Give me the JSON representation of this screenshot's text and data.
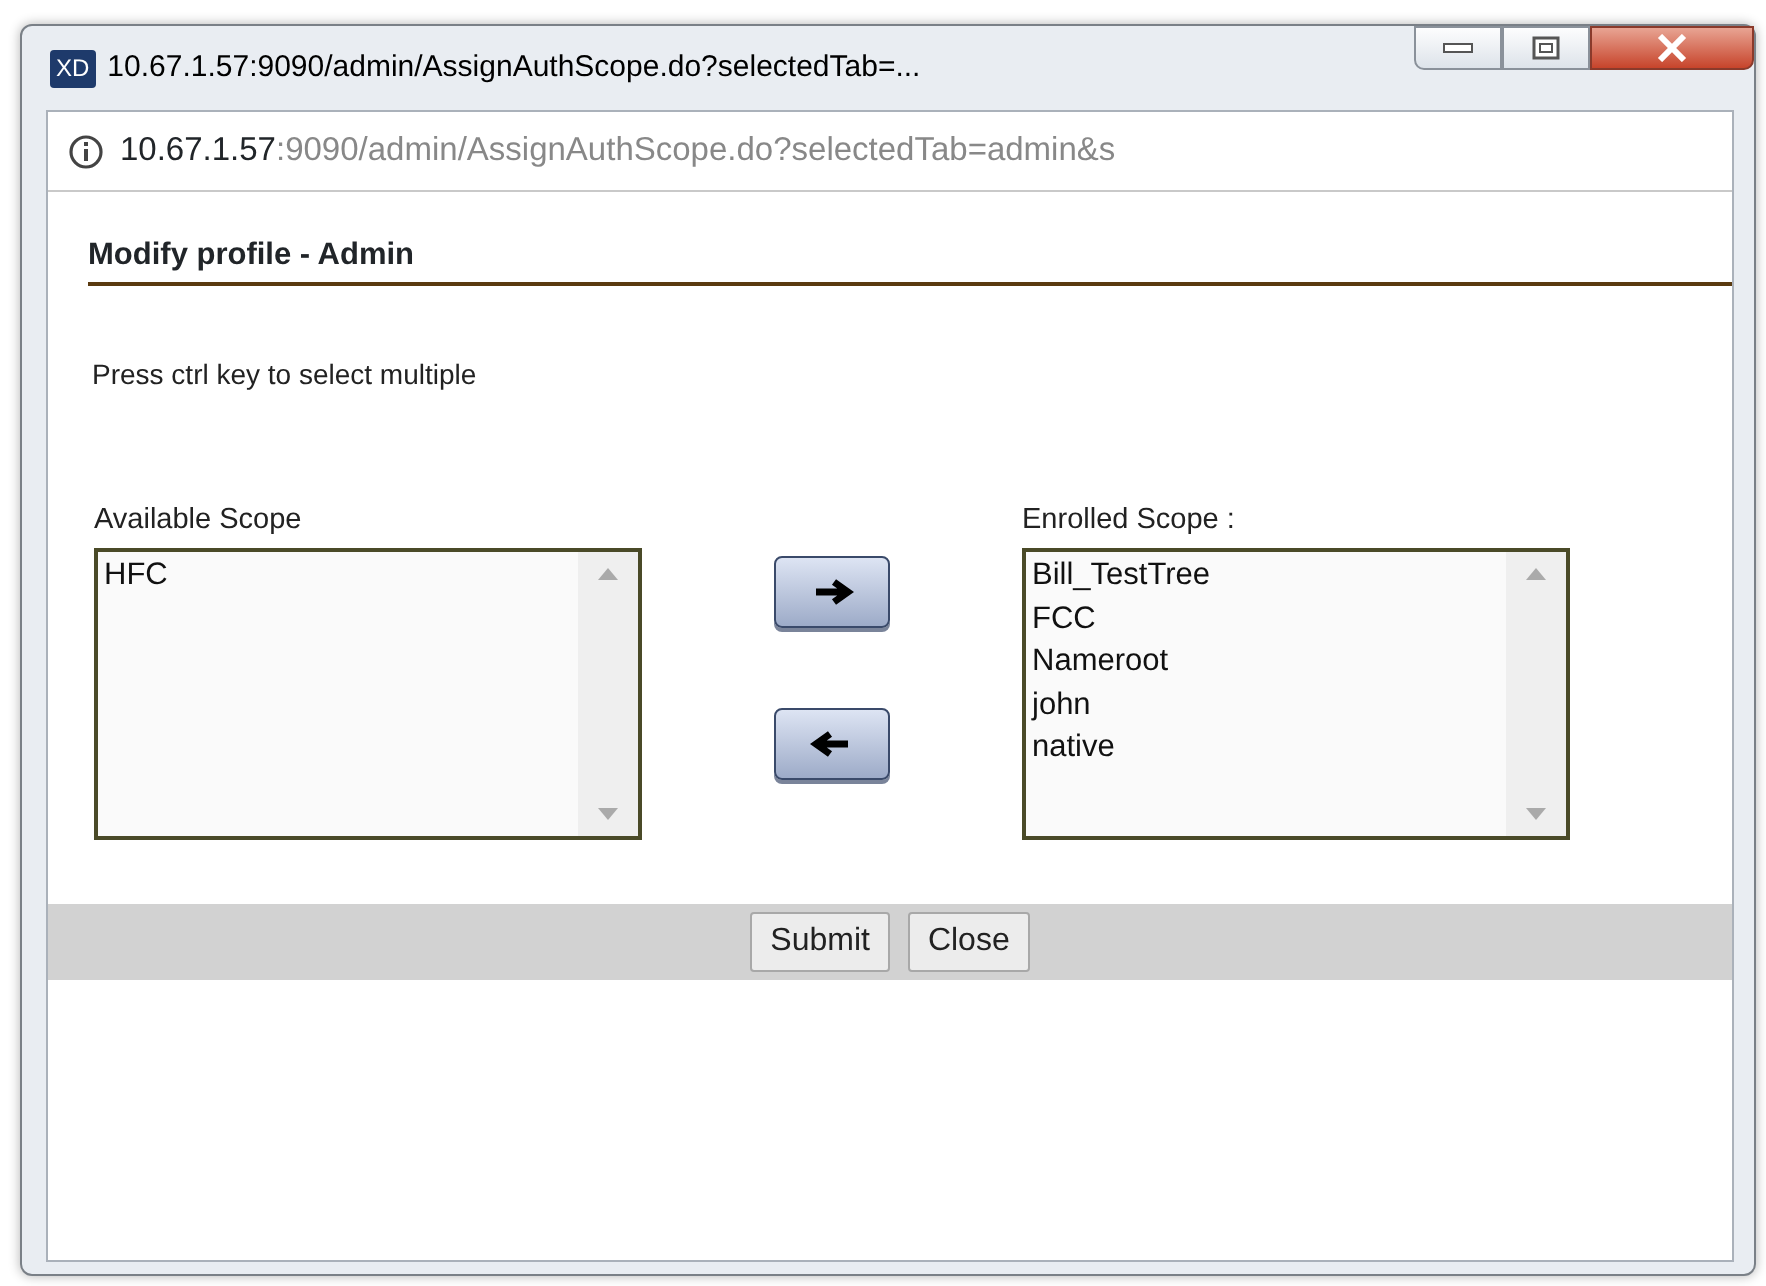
{
  "window": {
    "title": "10.67.1.57:9090/admin/AssignAuthScope.do?selectedTab=...",
    "app_badge": "XD"
  },
  "address_bar": {
    "host": "10.67.1.57",
    "rest": ":9090/admin/AssignAuthScope.do?selectedTab=admin&s"
  },
  "heading": "Modify profile - Admin",
  "hint": "Press ctrl key to select multiple",
  "available": {
    "label": "Available Scope",
    "items": [
      "HFC"
    ]
  },
  "enrolled": {
    "label": "Enrolled Scope :",
    "items": [
      "Bill_TestTree",
      "FCC",
      "Nameroot",
      "john",
      "native"
    ]
  },
  "move_buttons": [
    {
      "kind": "right"
    },
    {
      "kind": "left"
    }
  ],
  "buttons": [
    "Submit",
    "Close"
  ]
}
